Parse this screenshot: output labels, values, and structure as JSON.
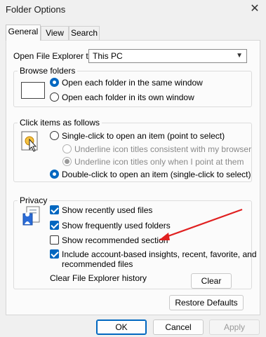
{
  "window": {
    "title": "Folder Options"
  },
  "tabs": [
    {
      "label": "General"
    },
    {
      "label": "View"
    },
    {
      "label": "Search"
    }
  ],
  "open_explorer": {
    "label": "Open File Explorer to:",
    "value": "This PC"
  },
  "browse": {
    "title": "Browse folders",
    "options": [
      {
        "label": "Open each folder in the same window",
        "selected": true
      },
      {
        "label": "Open each folder in its own window",
        "selected": false
      }
    ]
  },
  "click_items": {
    "title": "Click items as follows",
    "single": "Single-click to open an item (point to select)",
    "underline_browser": "Underline icon titles consistent with my browser",
    "underline_point": "Underline icon titles only when I point at them",
    "double": "Double-click to open an item (single-click to select)"
  },
  "privacy": {
    "title": "Privacy",
    "recent_files": "Show recently used files",
    "frequent_folders": "Show frequently used folders",
    "recommended": "Show recommended section",
    "account_line1": "Include account-based insights, recent, favorite, and",
    "account_line2": "recommended files",
    "clear_history": "Clear File Explorer history",
    "clear_button": "Clear"
  },
  "buttons": {
    "restore": "Restore Defaults",
    "ok": "OK",
    "cancel": "Cancel",
    "apply": "Apply"
  },
  "colors": {
    "accent": "#0067c0",
    "annotation_arrow": "#e02020"
  }
}
